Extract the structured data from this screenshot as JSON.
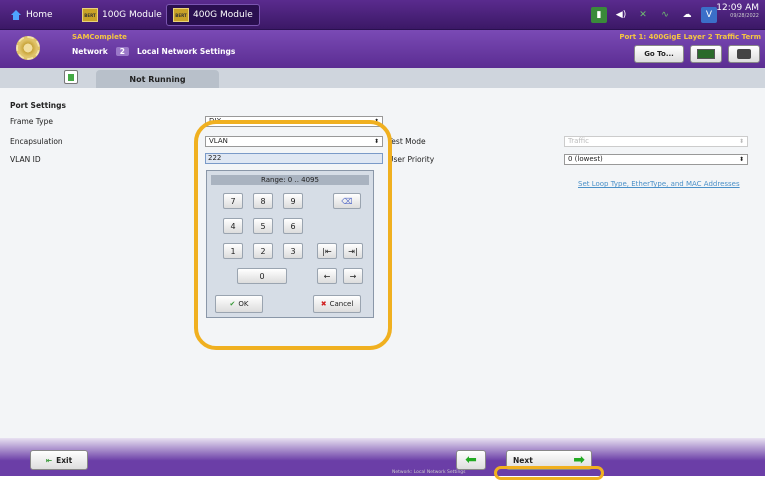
{
  "tabs": {
    "home": "Home",
    "module_100g": "100G Module",
    "module_400g": "400G Module"
  },
  "module_icon_text": "BERT",
  "clock": {
    "time": "12:09 AM",
    "date": "09/28/2022"
  },
  "header": {
    "app_name": "SAMComplete",
    "port_title": "Port 1: 400GigE Layer 2 Traffic Term",
    "breadcrumb": {
      "section": "Network",
      "step": "2",
      "page": "Local Network Settings"
    },
    "goto_label": "Go To..."
  },
  "run_status": "Not Running",
  "form": {
    "section_title": "Port Settings",
    "frame_type": {
      "label": "Frame Type",
      "value": "DIX"
    },
    "encapsulation": {
      "label": "Encapsulation",
      "value": "VLAN"
    },
    "vlan_id": {
      "label": "VLAN ID",
      "value": "222"
    },
    "test_mode": {
      "label": "Test Mode",
      "value": "Traffic"
    },
    "user_priority": {
      "label": "User Priority",
      "value": "0 (lowest)"
    },
    "link_text": "Set Loop Type, EtherType, and MAC Addresses"
  },
  "keypad": {
    "range_text": "Range: 0 .. 4095",
    "digits": [
      "7",
      "8",
      "9",
      "4",
      "5",
      "6",
      "1",
      "2",
      "3",
      "0"
    ],
    "ok_label": "OK",
    "cancel_label": "Cancel"
  },
  "footer": {
    "exit_label": "Exit",
    "next_label": "Next",
    "next_sub": "Network: Local Network Settings"
  },
  "colors": {
    "accent": "#5b2d92",
    "highlight": "#f0b020",
    "gold": "#f4c542"
  }
}
